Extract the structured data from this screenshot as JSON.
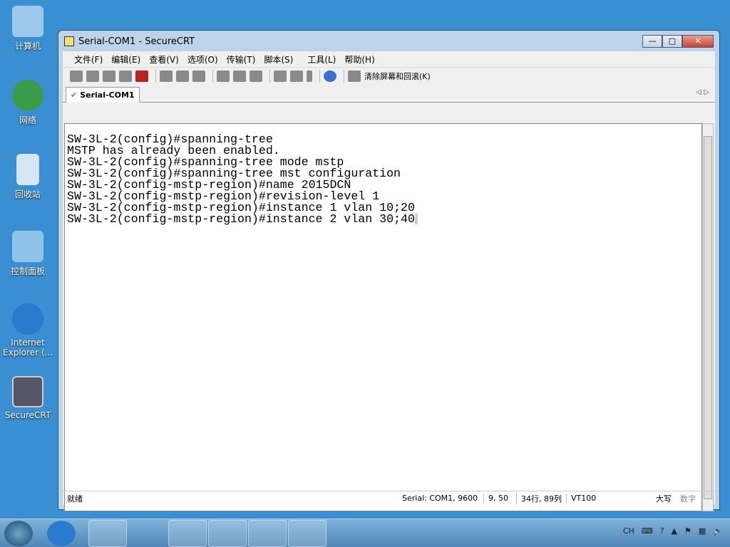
{
  "desktop": {
    "icons": [
      {
        "label": "计算机",
        "icon": "computer-icon"
      },
      {
        "label": "网络",
        "icon": "network-icon"
      },
      {
        "label": "回收站",
        "icon": "recycle-bin-icon"
      },
      {
        "label": "控制面板",
        "icon": "control-panel-icon"
      },
      {
        "label": "Internet Explorer (...",
        "icon": "ie-icon"
      },
      {
        "label": "SecureCRT",
        "icon": "securecrt-icon"
      }
    ]
  },
  "window": {
    "title": "Serial-COM1 - SecureCRT",
    "minimize": "—",
    "maximize": "□",
    "close": "✕"
  },
  "menu": [
    "文件(F)",
    "编辑(E)",
    "查看(V)",
    "选项(O)",
    "传输(T)",
    "脚本(S)",
    "工具(L)",
    "帮助(H)"
  ],
  "toolbar": {
    "clear_label": "清除屏幕和回滚(K)"
  },
  "tab": {
    "label": "Serial-COM1",
    "check": "✔",
    "nav_left": "◁",
    "nav_right": "▷"
  },
  "terminal": {
    "lines": [
      "SW-3L-2(config)#spanning-tree",
      "MSTP has already been enabled.",
      "SW-3L-2(config)#spanning-tree mode mstp",
      "SW-3L-2(config)#spanning-tree mst configuration",
      "SW-3L-2(config-mstp-region)#name 2015DCN",
      "SW-3L-2(config-mstp-region)#revision-level 1",
      "SW-3L-2(config-mstp-region)#instance 1 vlan 10;20",
      "SW-3L-2(config-mstp-region)#instance 2 vlan 30;40"
    ]
  },
  "status": {
    "ready": "就绪",
    "serial": "Serial: COM1, 9600",
    "pos": "9,  50",
    "size": "34行, 89列",
    "emu": "VT100",
    "caps": "大写",
    "num": "数字"
  },
  "tray": {
    "lang": "CH"
  }
}
